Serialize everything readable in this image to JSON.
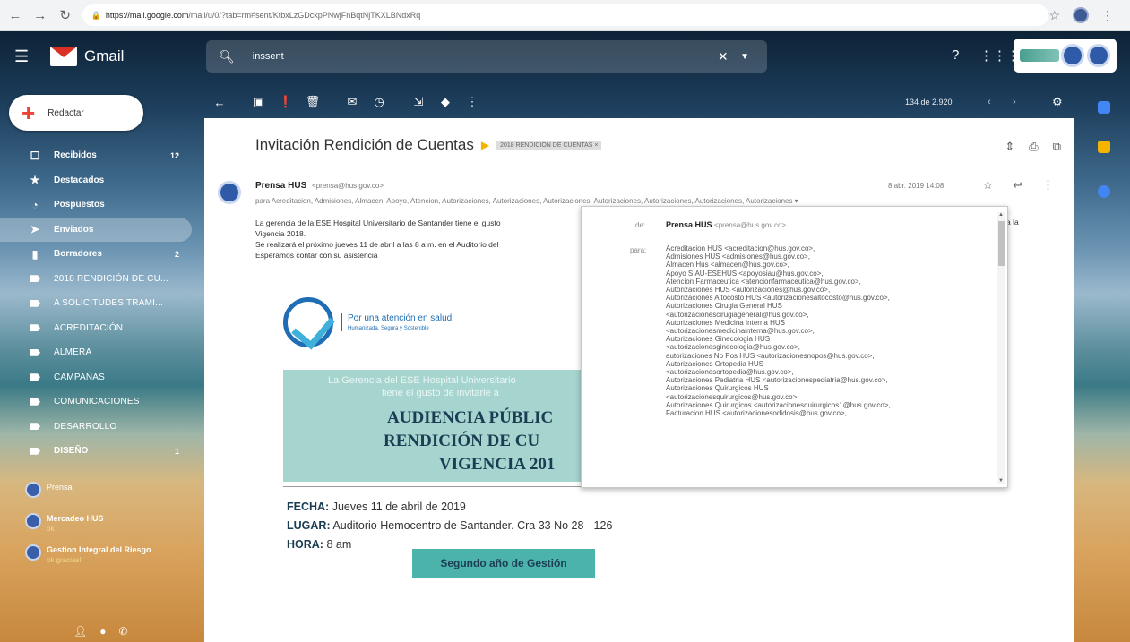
{
  "browser": {
    "url_host": "https://mail.google.com",
    "url_path": "/mail/u/0/?tab=rm#sent/KtbxLzGDckpPNwjFnBqtNjTKXLBNdxRq"
  },
  "header": {
    "app_name": "Gmail",
    "search_value": "inssent"
  },
  "sidebar": {
    "compose_label": "Redactar",
    "items": [
      {
        "label": "Recibidos",
        "count": "12",
        "icon": "inbox-icon"
      },
      {
        "label": "Destacados",
        "count": "",
        "icon": "star-icon"
      },
      {
        "label": "Pospuestos",
        "count": "",
        "icon": "clock-icon"
      },
      {
        "label": "Enviados",
        "count": "",
        "icon": "send-icon"
      },
      {
        "label": "Borradores",
        "count": "2",
        "icon": "draft-icon"
      },
      {
        "label": "2018 RENDICIÓN DE CU...",
        "count": "",
        "icon": "label-icon"
      },
      {
        "label": "A SOLICITUDES TRAMI...",
        "count": "",
        "icon": "label-icon"
      },
      {
        "label": "ACREDITACIÓN",
        "count": "",
        "icon": "label-icon"
      },
      {
        "label": "ALMERA",
        "count": "",
        "icon": "label-icon"
      },
      {
        "label": "CAMPAÑAS",
        "count": "",
        "icon": "label-icon"
      },
      {
        "label": "COMUNICACIONES",
        "count": "",
        "icon": "label-icon"
      },
      {
        "label": "DESARROLLO",
        "count": "",
        "icon": "label-icon"
      },
      {
        "label": "DISEÑO",
        "count": "1",
        "icon": "label-icon"
      }
    ],
    "contacts": [
      {
        "name": "Prensa",
        "status": ""
      },
      {
        "name": "Mercadeo HUS",
        "status": "ok"
      },
      {
        "name": "Gestion Integral del Riesgo",
        "status": "ok gracias!!"
      }
    ]
  },
  "toolbar": {
    "pager": "134 de 2.920"
  },
  "message": {
    "subject": "Invitación Rendición de Cuentas",
    "label_chip": "2018 RENDICIÓN DE CUENTAS ×",
    "sender_name": "Prensa HUS",
    "sender_email": "<prensa@hus.gov.co>",
    "to_line": "para Acreditacion, Admisiones, Almacen, Apoyo, Atencion, Autorizaciones, Autorizaciones, Autorizaciones, Autorizaciones, Autorizaciones, Autorizaciones, Autorizaciones ▾",
    "date": "8 abr. 2019 14:08",
    "body_lines": [
      "La gerencia de la ESE Hospital Universitario de Santander tiene el gusto",
      "Vigencia 2018.",
      "Se realizará el próximo jueves 11 de abril a las 8 a m. en el Auditorio del",
      "Esperamos contar con su asistencia"
    ],
    "body_right_fragment": "a la",
    "invite": {
      "slogan": "Por una atención en salud",
      "slogan_sub": "Humanizada, Segura y Sostenible",
      "banner_top_1": "La Gerencia del ESE Hospital Universitario",
      "banner_top_2": "tiene el gusto de invitarle a",
      "banner_line_1": "AUDIENCIA PÚBLIC",
      "banner_line_2": "RENDICIÓN DE CU",
      "banner_line_3": "VIGENCIA 201",
      "fecha_label": "FECHA:",
      "fecha_value": "Jueves 11 de abril de 2019",
      "lugar_label": "LUGAR:",
      "lugar_value": "Auditorio Hemocentro de Santander. Cra 33 No 28 - 126",
      "hora_label": "HORA:",
      "hora_value": "8 am",
      "button_label": "Segundo año de Gestión"
    }
  },
  "popup": {
    "de_label": "de:",
    "from_name": "Prensa HUS",
    "from_email": "<prensa@hus.gov.co>",
    "para_label": "para:",
    "recipients": [
      "Acreditacion HUS <acreditacion@hus.gov.co>,",
      "Admisiones HUS <admisiones@hus.gov.co>,",
      "Almacen Hus <almacen@hus.gov.co>,",
      "Apoyo SIAU-ESEHUS <apoyosiau@hus.gov.co>,",
      "Atencion Farmaceutica <atencionfarmaceutica@hus.gov.co>,",
      "Autorizaciones HUS <autorizaciones@hus.gov.co>,",
      "Autorizaciones Altocosto HUS <autorizacionesaltocosto@hus.gov.co>,",
      "Autorizaciones Cirugia General HUS",
      "<autorizacionescirugiageneral@hus.gov.co>,",
      "Autorizaciones Medicina Interna HUS",
      "<autorizacionesmedicinainterna@hus.gov.co>,",
      "Autorizaciones Ginecologia HUS",
      "<autorizacionesginecologia@hus.gov.co>,",
      "autorizaciones No Pos HUS <autorizacionesnopos@hus.gov.co>,",
      "Autorizaciones Ortopedia HUS",
      "<autorizacionesortopedia@hus.gov.co>,",
      "Autorizaciones Pediatria HUS <autorizacionespediatria@hus.gov.co>,",
      "Autorizaciones Quirurgicos HUS",
      "<autorizacionesquirurgicos@hus.gov.co>,",
      "Autorizaciones Quirurgicos <autorizacionesquirurgicos1@hus.gov.co>,",
      "Facturacion HUS <autorizacionesodidosis@hus.gov.co>,"
    ]
  },
  "colors": {
    "banner_bg": "#a6d4cf",
    "button_bg": "#4bb3a9",
    "brand_blue": "#1f6db4"
  }
}
